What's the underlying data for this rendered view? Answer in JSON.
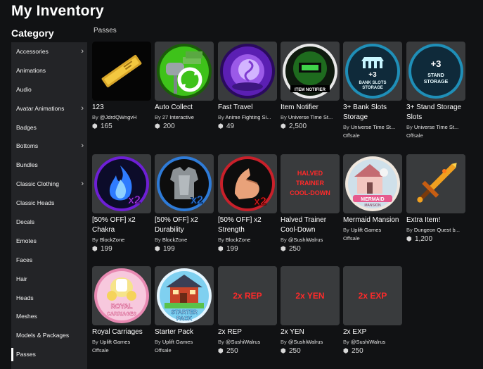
{
  "header": {
    "title": "My Inventory"
  },
  "sidebar": {
    "title": "Category",
    "items": [
      {
        "label": "Accessories",
        "chevron": true
      },
      {
        "label": "Animations",
        "chevron": false
      },
      {
        "label": "Audio",
        "chevron": false
      },
      {
        "label": "Avatar Animations",
        "chevron": true
      },
      {
        "label": "Badges",
        "chevron": false
      },
      {
        "label": "Bottoms",
        "chevron": true
      },
      {
        "label": "Bundles",
        "chevron": false
      },
      {
        "label": "Classic Clothing",
        "chevron": true
      },
      {
        "label": "Classic Heads",
        "chevron": false
      },
      {
        "label": "Decals",
        "chevron": false
      },
      {
        "label": "Emotes",
        "chevron": false
      },
      {
        "label": "Faces",
        "chevron": false
      },
      {
        "label": "Hair",
        "chevron": false
      },
      {
        "label": "Heads",
        "chevron": false
      },
      {
        "label": "Meshes",
        "chevron": false
      },
      {
        "label": "Models & Packages",
        "chevron": false
      },
      {
        "label": "Passes",
        "chevron": false,
        "selected": true
      }
    ]
  },
  "section": {
    "title": "Passes"
  },
  "labels": {
    "by": "By",
    "robux_icon": "robux-icon"
  },
  "items": [
    {
      "name": "123",
      "creator": "@JdrdQWngvH",
      "price": "165",
      "offsale": "",
      "thumb_text": "",
      "icon": "golden-ticket-icon"
    },
    {
      "name": "Auto Collect",
      "creator": "27 Interactive",
      "price": "200",
      "offsale": "",
      "thumb_text": "",
      "icon": "mailbox-autocollect-icon"
    },
    {
      "name": "Fast Travel",
      "creator": "Anime Fighting Si...",
      "price": "49",
      "offsale": "",
      "thumb_text": "",
      "icon": "portal-swirl-icon"
    },
    {
      "name": "Item Notifier",
      "creator": "Universe Time St...",
      "price": "2,500",
      "offsale": "",
      "thumb_text": "ITEM NOTIFIER",
      "icon": "item-notifier-icon"
    },
    {
      "name": "3+ Bank Slots Storage",
      "creator": "Universe Time St...",
      "price": "",
      "offsale": "Offsale",
      "thumb_text": "+3 BANK SLOTS STORAGE",
      "icon": "bank-storage-icon"
    },
    {
      "name": "3+ Stand Storage Slots",
      "creator": "Universe Time St...",
      "price": "",
      "offsale": "Offsale",
      "thumb_text": "+3 STAND STORAGE",
      "icon": "stand-storage-icon"
    },
    {
      "name": "[50% OFF] x2 Chakra",
      "creator": "BlockZone",
      "price": "199",
      "offsale": "",
      "thumb_text": "x2",
      "icon": "blue-flame-icon"
    },
    {
      "name": "[50% OFF] x2 Durability",
      "creator": "BlockZone",
      "price": "199",
      "offsale": "",
      "thumb_text": "x2",
      "icon": "armor-icon"
    },
    {
      "name": "[50% OFF] x2 Strength",
      "creator": "BlockZone",
      "price": "199",
      "offsale": "",
      "thumb_text": "x2",
      "icon": "muscle-arm-icon"
    },
    {
      "name": "Halved Trainer Cool-Down",
      "creator": "@SushiWalrus",
      "price": "250",
      "offsale": "",
      "thumb_text": "HALVED TRAINER COOL-DOWN",
      "icon": "text-thumbnail"
    },
    {
      "name": "Mermaid Mansion",
      "creator": "Uplift Games",
      "price": "",
      "offsale": "Offsale",
      "thumb_text": "MERMAID MANSION",
      "icon": "mermaid-mansion-icon"
    },
    {
      "name": "Extra Item!",
      "creator": "Dungeon Quest b...",
      "price": "1,200",
      "offsale": "",
      "thumb_text": "",
      "icon": "golden-sword-icon"
    },
    {
      "name": "Royal Carriages",
      "creator": "Uplift Games",
      "price": "",
      "offsale": "Offsale",
      "thumb_text": "ROYAL CARRIAGES",
      "icon": "royal-carriage-icon"
    },
    {
      "name": "Starter Pack",
      "creator": "Uplift Games",
      "price": "",
      "offsale": "Offsale",
      "thumb_text": "STARTER PACK",
      "icon": "starter-house-icon"
    },
    {
      "name": "2x REP",
      "creator": "@SushiWalrus",
      "price": "250",
      "offsale": "",
      "thumb_text": "2x REP",
      "icon": "text-thumbnail"
    },
    {
      "name": "2x YEN",
      "creator": "@SushiWalrus",
      "price": "250",
      "offsale": "",
      "thumb_text": "2x YEN",
      "icon": "text-thumbnail"
    },
    {
      "name": "2x EXP",
      "creator": "@SushiWalrus",
      "price": "250",
      "offsale": "",
      "thumb_text": "2x EXP",
      "icon": "text-thumbnail"
    }
  ]
}
